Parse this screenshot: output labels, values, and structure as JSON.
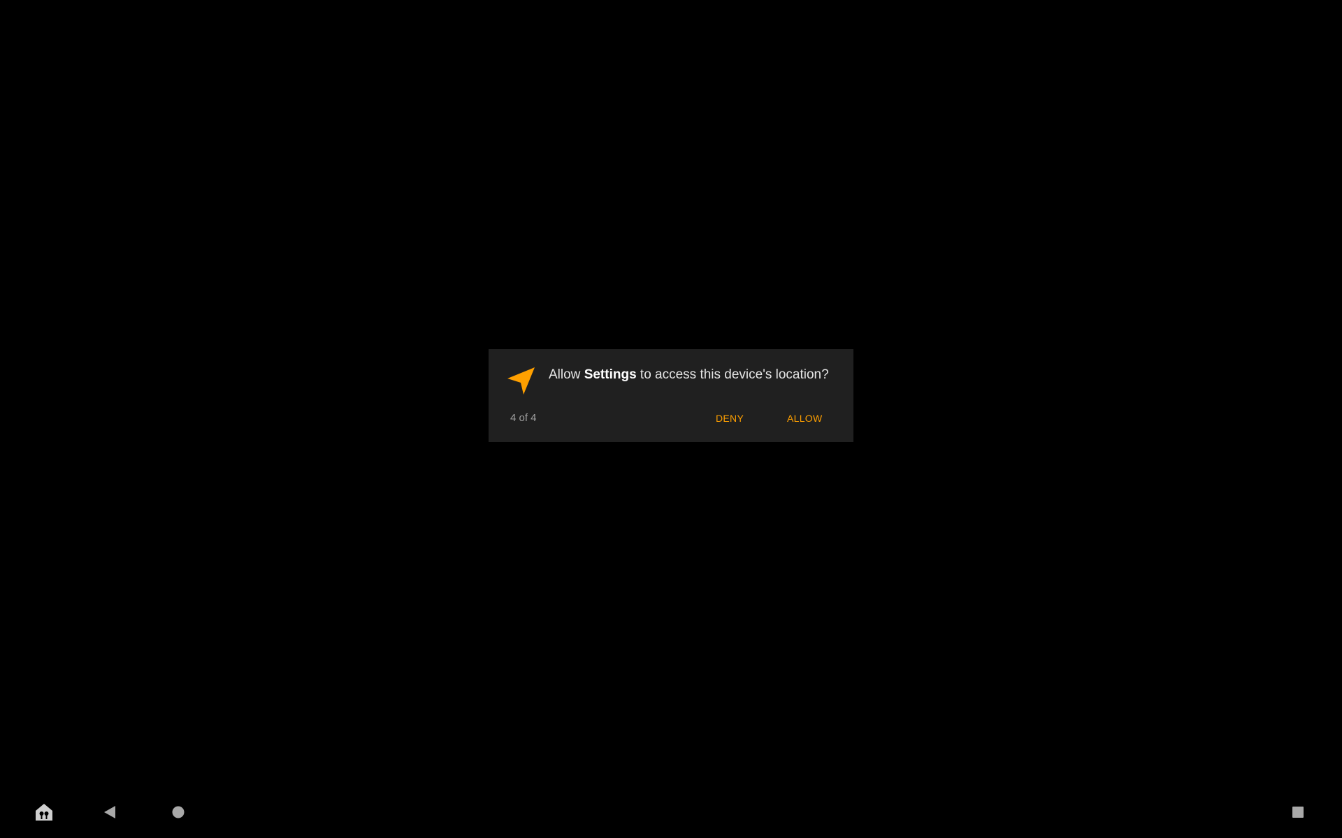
{
  "dialog": {
    "message_prefix": "Allow ",
    "app_name": "Settings",
    "message_suffix": " to access this device's location?",
    "counter": "4 of 4",
    "deny_label": "DENY",
    "allow_label": "ALLOW",
    "icon": "location-arrow-icon"
  },
  "colors": {
    "background": "#000000",
    "dialog_background": "#202020",
    "accent": "#ffa000"
  },
  "navbar": {
    "items": [
      {
        "icon": "home-app-icon"
      },
      {
        "icon": "back-icon"
      },
      {
        "icon": "home-icon"
      },
      {
        "icon": "recents-icon"
      }
    ]
  }
}
